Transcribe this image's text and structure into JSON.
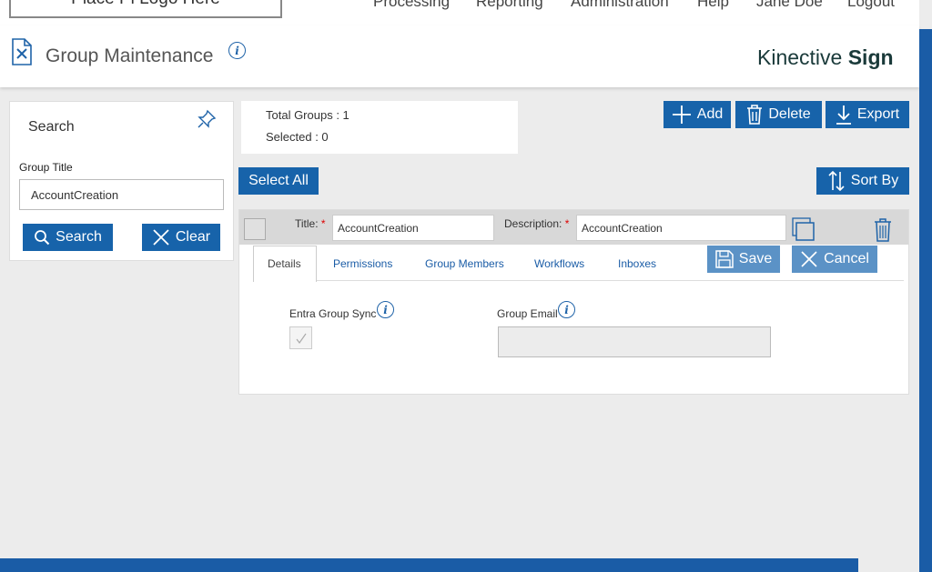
{
  "nav": {
    "logo_text": "Place Pi Logo Here",
    "items": [
      "Processing",
      "Reporting",
      "Administration",
      "Help",
      "Jane Doe",
      "Logout"
    ]
  },
  "header": {
    "title": "Group Maintenance",
    "brand_light": "Kinective",
    "brand_bold": "Sign"
  },
  "search": {
    "heading": "Search",
    "group_title_label": "Group Title",
    "group_title_value": "AccountCreation",
    "search_button": "Search",
    "clear_button": "Clear"
  },
  "stats": {
    "total_groups": "Total Groups : 1",
    "selected": "Selected : 0"
  },
  "toolbar": {
    "add": "Add",
    "delete": "Delete",
    "export": "Export",
    "select_all": "Select All",
    "sort_by": "Sort By"
  },
  "group": {
    "title_label": "Title:",
    "title_value": "AccountCreation",
    "description_label": "Description:",
    "description_value": "AccountCreation",
    "required_mark": "*"
  },
  "tabs": [
    {
      "label": "Details",
      "active": true
    },
    {
      "label": "Permissions"
    },
    {
      "label": "Group Members"
    },
    {
      "label": "Workflows"
    },
    {
      "label": "Inboxes"
    }
  ],
  "actions": {
    "save": "Save",
    "cancel": "Cancel"
  },
  "details": {
    "entra_sync_label": "Entra Group Sync",
    "entra_sync_checked": true,
    "group_email_label": "Group Email",
    "group_email_value": ""
  },
  "colors": {
    "primary": "#1763aa",
    "disabled_button": "#5b92c6",
    "scrollbar": "#1a5ca6"
  }
}
